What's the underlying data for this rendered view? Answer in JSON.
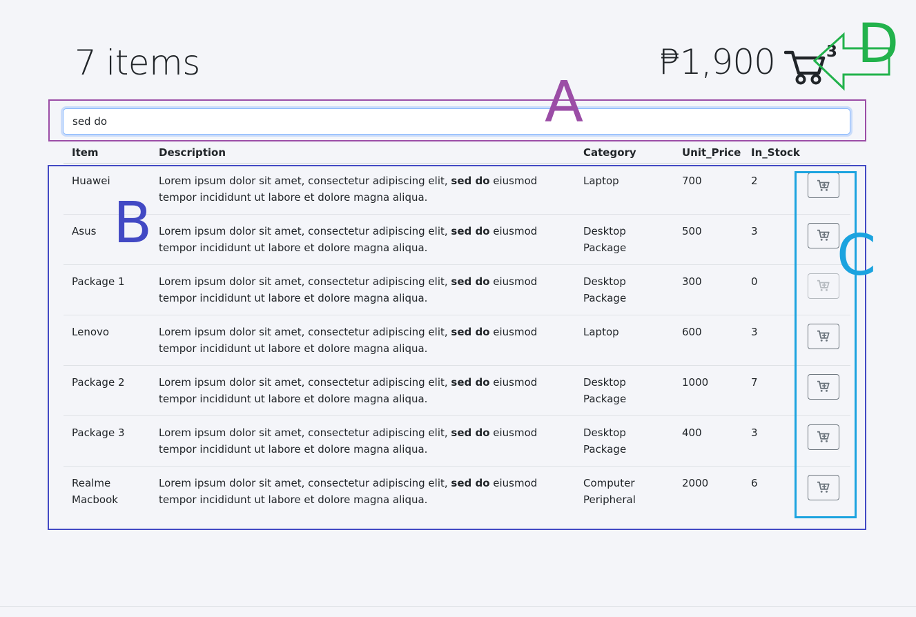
{
  "header": {
    "item_count": "7",
    "item_count_label": "items",
    "cart_total": "₱1,900",
    "cart_count": "3"
  },
  "search": {
    "value": "sed do",
    "placeholder": ""
  },
  "table": {
    "columns": [
      "Item",
      "Description",
      "Category",
      "Unit_Price",
      "In_Stock"
    ],
    "description_before": "Lorem ipsum dolor sit amet, consectetur adipiscing elit, ",
    "description_highlight": "sed do",
    "description_after": " eiusmod tempor incididunt ut labore et dolore magna aliqua.",
    "rows": [
      {
        "item": "Huawei",
        "category": "Laptop",
        "unit_price": "700",
        "in_stock": "2",
        "disabled": false
      },
      {
        "item": "Asus",
        "category": "Desktop Package",
        "unit_price": "500",
        "in_stock": "3",
        "disabled": false
      },
      {
        "item": "Package 1",
        "category": "Desktop Package",
        "unit_price": "300",
        "in_stock": "0",
        "disabled": true
      },
      {
        "item": "Lenovo",
        "category": "Laptop",
        "unit_price": "600",
        "in_stock": "3",
        "disabled": false
      },
      {
        "item": "Package 2",
        "category": "Desktop Package",
        "unit_price": "1000",
        "in_stock": "7",
        "disabled": false
      },
      {
        "item": "Package 3",
        "category": "Desktop Package",
        "unit_price": "400",
        "in_stock": "3",
        "disabled": false
      },
      {
        "item": "Realme Macbook",
        "category": "Computer Peripheral",
        "unit_price": "2000",
        "in_stock": "6",
        "disabled": false
      }
    ]
  },
  "annotations": {
    "a": "A",
    "b": "B",
    "c": "C",
    "d": "D",
    "colors": {
      "a": "#9b4da6",
      "b": "#4249c4",
      "c": "#1ba3df",
      "d": "#22b24c"
    }
  },
  "icons": {
    "cart": "cart-icon",
    "add_to_cart": "cart-plus-icon",
    "arrow": "arrow-left-icon"
  }
}
